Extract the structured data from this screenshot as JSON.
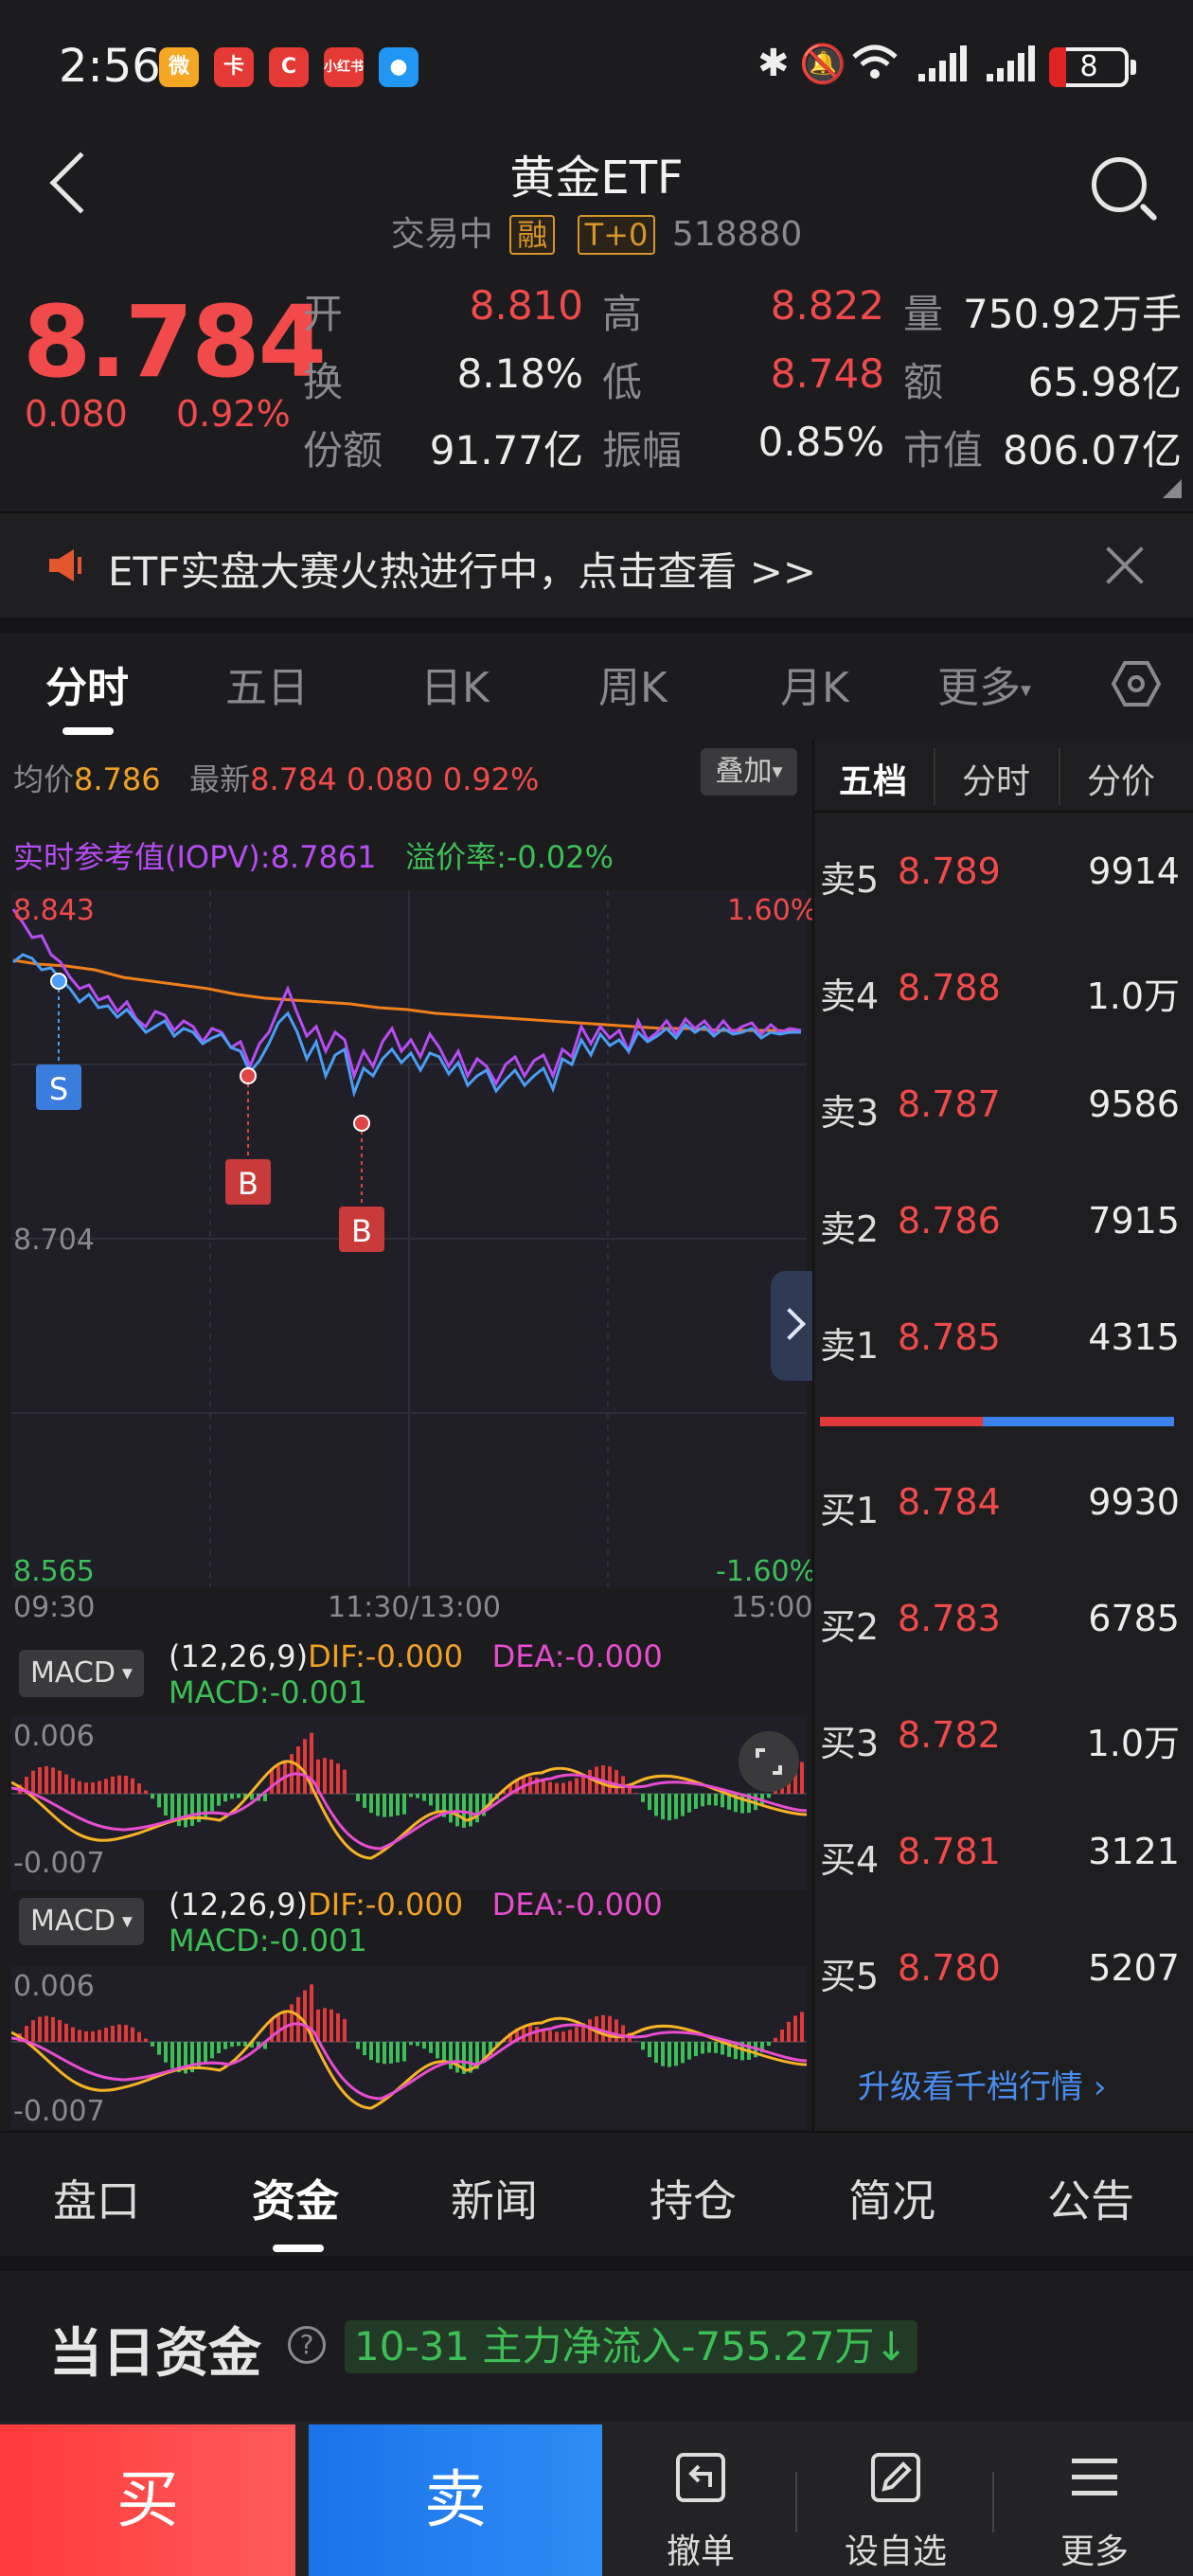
{
  "status_bar": {
    "time": "2:56",
    "battery": "8"
  },
  "header": {
    "title": "黄金ETF",
    "status": "交易中",
    "tag_margin": "融",
    "tag_t0": "T+0",
    "code": "518880"
  },
  "quote": {
    "price": "8.784",
    "change": "0.080",
    "change_pct": "0.92%",
    "open_label": "开",
    "open": "8.810",
    "high_label": "高",
    "high": "8.822",
    "volume_label": "量",
    "volume": "750.92万手",
    "turnover_label": "换",
    "turnover": "8.18%",
    "low_label": "低",
    "low": "8.748",
    "amount_label": "额",
    "amount": "65.98亿",
    "shares_label": "份额",
    "shares": "91.77亿",
    "amplitude_label": "振幅",
    "amplitude": "0.85%",
    "mktcap_label": "市值",
    "mktcap": "806.07亿"
  },
  "banner": {
    "text": "ETF实盘大赛火热进行中，点击查看 >>"
  },
  "chart_tabs": [
    {
      "label": "分时"
    },
    {
      "label": "五日"
    },
    {
      "label": "日K"
    },
    {
      "label": "周K"
    },
    {
      "label": "月K"
    },
    {
      "label": "更多"
    }
  ],
  "intraday": {
    "avg_label": "均价",
    "avg": "8.786",
    "latest_label": "最新",
    "latest": "8.784",
    "chg": "0.080",
    "chg_pct": "0.92%",
    "overlay_label": "叠加",
    "iopv": "实时参考值(IOPV):8.7861",
    "premium": "溢价率:-0.02%",
    "y_high": "8.843",
    "y_mid": "8.704",
    "y_low": "8.565",
    "pct_high": "1.60%",
    "pct_low": "-1.60%",
    "t_start": "09:30",
    "t_mid": "11:30/13:00",
    "t_end": "15:00",
    "markers": {
      "s": "S",
      "b": "B"
    }
  },
  "macd": [
    {
      "selector": "MACD",
      "params": "(12,26,9)",
      "dif": "DIF:-0.000",
      "dea": "DEA:-0.000",
      "macd": "MACD:-0.001",
      "top": "0.006",
      "bottom": "-0.007"
    },
    {
      "selector": "MACD",
      "params": "(12,26,9)",
      "dif": "DIF:-0.000",
      "dea": "DEA:-0.000",
      "macd": "MACD:-0.001",
      "top": "0.006",
      "bottom": "-0.007"
    }
  ],
  "order_book": {
    "tabs": [
      {
        "label": "五档"
      },
      {
        "label": "分时"
      },
      {
        "label": "分价"
      }
    ],
    "asks": [
      {
        "label": "卖5",
        "price": "8.789",
        "vol": "9914"
      },
      {
        "label": "卖4",
        "price": "8.788",
        "vol": "1.0万"
      },
      {
        "label": "卖3",
        "price": "8.787",
        "vol": "9586"
      },
      {
        "label": "卖2",
        "price": "8.786",
        "vol": "7915"
      },
      {
        "label": "卖1",
        "price": "8.785",
        "vol": "4315"
      }
    ],
    "bids": [
      {
        "label": "买1",
        "price": "8.784",
        "vol": "9930"
      },
      {
        "label": "买2",
        "price": "8.783",
        "vol": "6785"
      },
      {
        "label": "买3",
        "price": "8.782",
        "vol": "1.0万"
      },
      {
        "label": "买4",
        "price": "8.781",
        "vol": "3121"
      },
      {
        "label": "买5",
        "price": "8.780",
        "vol": "5207"
      }
    ],
    "upgrade": "升级看千档行情"
  },
  "bottom_tabs": [
    {
      "label": "盘口"
    },
    {
      "label": "资金"
    },
    {
      "label": "新闻"
    },
    {
      "label": "持仓"
    },
    {
      "label": "简况"
    },
    {
      "label": "公告"
    }
  ],
  "funds": {
    "title": "当日资金",
    "flow": "10-31 主力净流入-755.27万"
  },
  "actions": {
    "buy": "买",
    "sell": "卖",
    "cancel": "撤单",
    "watch": "设自选",
    "more": "更多"
  },
  "colors": {
    "up": "#f24a4a",
    "down": "#3dbf57",
    "price_line": "#4a9ef5",
    "avg_line": "#f07e1a",
    "iopv_line": "#b84cf5"
  }
}
